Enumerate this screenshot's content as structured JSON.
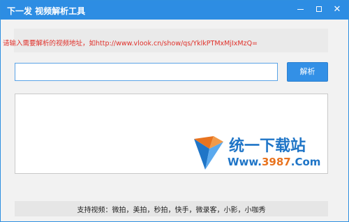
{
  "window": {
    "title": "下一发 视频解析工具",
    "controls": {
      "minimize_icon": "minimize-icon",
      "maximize_icon": "maximize-icon",
      "close_icon": "close-icon",
      "close_glyph": "✕"
    }
  },
  "hint": {
    "text": "请输入需要解析的视频地址，如http://www.vlook.cn/show/qs/YklkPTMxMjIxMzQ="
  },
  "url_input": {
    "value": "",
    "placeholder": ""
  },
  "parse_button": {
    "label": "解析"
  },
  "result": {
    "text": ""
  },
  "watermark": {
    "name": "统一下载站",
    "url_prefix": "Www.",
    "url_number": "3987",
    "url_suffix": ".Com"
  },
  "support": {
    "text": "支持视频：微拍，美拍，秒拍，快手，微录客，小影，小咖秀"
  },
  "colors": {
    "titlebar": "#2d8de3",
    "hint_text": "#e0302a",
    "button": "#3390e6",
    "watermark_blue": "#1f75c7",
    "watermark_orange": "#e8731f"
  }
}
